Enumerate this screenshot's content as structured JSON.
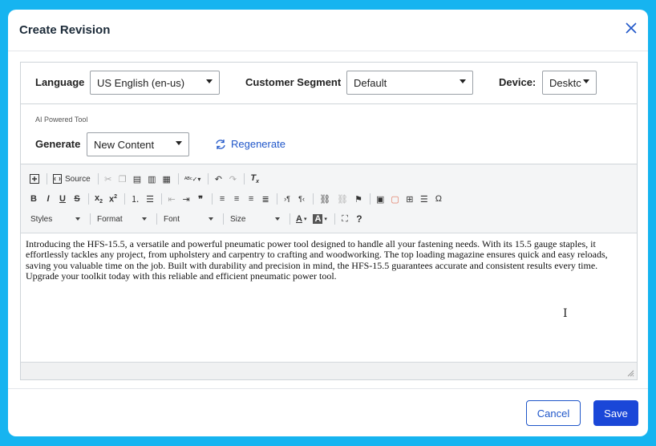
{
  "modal": {
    "title": "Create Revision"
  },
  "filters": {
    "language_label": "Language",
    "language_value": "US English (en-us)",
    "segment_label": "Customer Segment",
    "segment_value": "Default",
    "device_label": "Device:",
    "device_value": "Desktc"
  },
  "ai": {
    "label": "AI Powered Tool",
    "generate_label": "Generate",
    "generate_value": "New Content",
    "regenerate_label": "Regenerate"
  },
  "toolbar": {
    "source_label": "Source",
    "styles_label": "Styles",
    "format_label": "Format",
    "font_label": "Font",
    "size_label": "Size",
    "help_label": "?"
  },
  "editor": {
    "content": "Introducing the HFS-15.5, a versatile and powerful pneumatic power tool designed to handle all your fastening needs. With its 15.5 gauge staples, it effortlessly tackles any project, from upholstery and carpentry to crafting and woodworking. The top loading magazine ensures quick and easy reloads, saving you valuable time on the job. Built with durability and precision in mind, the HFS-15.5 guarantees accurate and consistent results every time. Upgrade your toolkit today with this reliable and efficient pneumatic power tool."
  },
  "footer": {
    "cancel_label": "Cancel",
    "save_label": "Save"
  },
  "colors": {
    "accent": "#1f56c9",
    "save": "#1a47d8",
    "frame": "#16b4f0"
  }
}
